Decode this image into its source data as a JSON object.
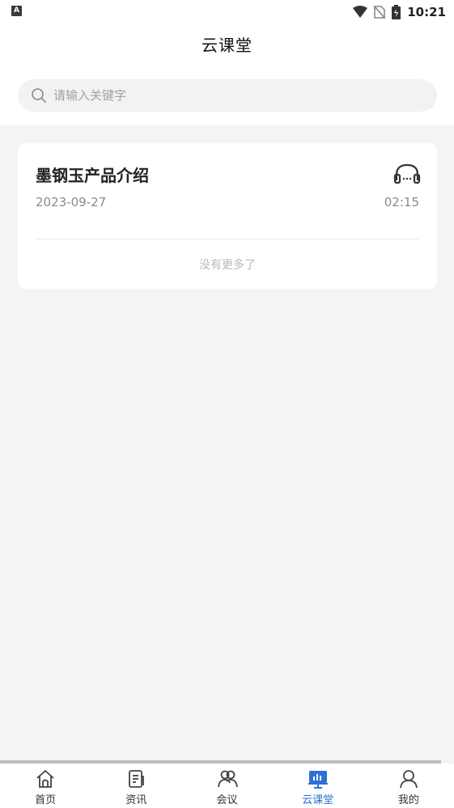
{
  "status": {
    "time": "10:21",
    "indicator": "A"
  },
  "header": {
    "title": "云课堂"
  },
  "search": {
    "placeholder": "请输入关键字"
  },
  "course": {
    "title": "墨钢玉产品介绍",
    "date": "2023-09-27",
    "duration": "02:15"
  },
  "list_end_text": "没有更多了",
  "tabs": [
    {
      "label": "首页",
      "icon": "home-icon"
    },
    {
      "label": "资讯",
      "icon": "news-icon"
    },
    {
      "label": "会议",
      "icon": "meeting-icon"
    },
    {
      "label": "云课堂",
      "icon": "classroom-icon",
      "active": true
    },
    {
      "label": "我的",
      "icon": "profile-icon"
    }
  ],
  "colors": {
    "accent": "#2f6fd6",
    "background": "#f4f4f4"
  }
}
